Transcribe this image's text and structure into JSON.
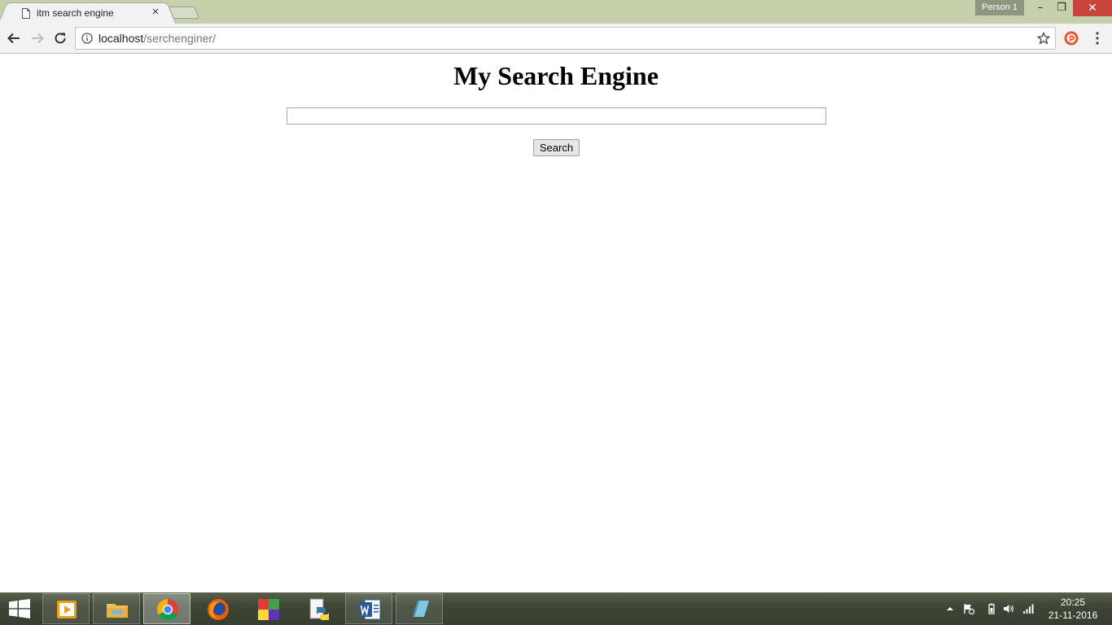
{
  "browser": {
    "tab": {
      "title": "itm search engine",
      "close_glyph": "×"
    },
    "profile_label": "Person 1",
    "window_controls": {
      "minimize": "–",
      "maximize": "❐",
      "close": "✕"
    },
    "address": {
      "host": "localhost",
      "path": "/serchenginer/"
    }
  },
  "page": {
    "heading": "My Search Engine",
    "search_input_value": "",
    "search_button_label": "Search"
  },
  "taskbar": {
    "apps": [
      "media-player-icon",
      "file-explorer-icon",
      "chrome-icon",
      "firefox-icon",
      "colorful-app-icon",
      "python-icon",
      "word-icon",
      "notepad-icon"
    ],
    "active_app": "chrome-icon",
    "clock": {
      "time": "20:25",
      "date": "21-11-2016"
    }
  },
  "colors": {
    "titlebar": "#c3d0a9",
    "toolbar": "#f2f2f2",
    "close_button": "#c7443a",
    "taskbar": "#3f4a38"
  }
}
